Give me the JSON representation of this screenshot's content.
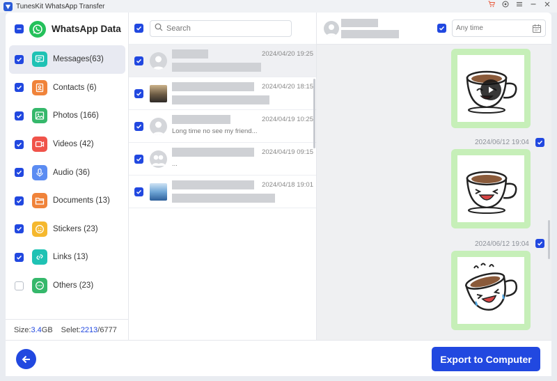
{
  "window": {
    "title": "TunesKit WhatsApp Transfer",
    "controls": [
      "cart-icon",
      "feedback-icon",
      "menu-icon",
      "minimize-icon",
      "close-icon"
    ]
  },
  "sidebar": {
    "title": "WhatsApp Data",
    "items": [
      {
        "label": "Messages(63)",
        "icon": "messages-icon",
        "color": "#1fc2b4",
        "checked": true,
        "active": true
      },
      {
        "label": "Contacts (6)",
        "icon": "contacts-icon",
        "color": "#f0833a",
        "checked": true
      },
      {
        "label": "Photos (166)",
        "icon": "photos-icon",
        "color": "#35b86b",
        "checked": true
      },
      {
        "label": "Videos (42)",
        "icon": "videos-icon",
        "color": "#f0534a",
        "checked": true
      },
      {
        "label": "Audio (36)",
        "icon": "audio-icon",
        "color": "#5b8cf2",
        "checked": true
      },
      {
        "label": "Documents (13)",
        "icon": "documents-icon",
        "color": "#f0833a",
        "checked": true
      },
      {
        "label": "Stickers (23)",
        "icon": "stickers-icon",
        "color": "#f5b82e",
        "checked": true
      },
      {
        "label": "Links (13)",
        "icon": "links-icon",
        "color": "#1fc2b4",
        "checked": true
      },
      {
        "label": "Others (23)",
        "icon": "others-icon",
        "color": "#35b86b",
        "checked": false
      }
    ],
    "footer": {
      "size_label": "Size: ",
      "size_value": "3.4",
      "size_unit": " GB",
      "select_label": "Selet: ",
      "select_value": "2213",
      "select_total": "/6777"
    }
  },
  "search": {
    "placeholder": "Search"
  },
  "conversations": [
    {
      "time": "2024/04/20 19:25",
      "preview": "",
      "avatar": "default",
      "selected": true
    },
    {
      "time": "2024/04/20 18:15",
      "preview": "",
      "avatar": "photo-sunset"
    },
    {
      "time": "2024/04/19 10:25",
      "preview": "Long time no see my friend...",
      "avatar": "default"
    },
    {
      "time": "2024/04/19 09:15",
      "preview": "...",
      "avatar": "group"
    },
    {
      "time": "2024/04/18 19:01",
      "preview": "",
      "avatar": "photo-sky"
    }
  ],
  "chat": {
    "date_placeholder": "Any time",
    "messages": [
      {
        "type": "video-sticker",
        "time": ""
      },
      {
        "type": "sticker",
        "time": "2024/06/12 19:04"
      },
      {
        "type": "sticker",
        "time": "2024/06/12 19:04"
      }
    ]
  },
  "bottom": {
    "export_label": "Export to Computer"
  },
  "colors": {
    "accent": "#2148e0",
    "sticker_bg": "#c6efb8"
  }
}
